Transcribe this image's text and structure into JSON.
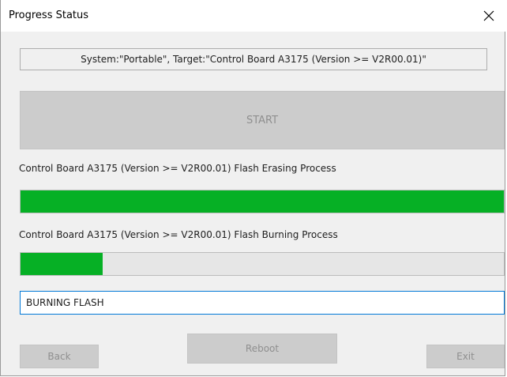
{
  "window": {
    "title": "Progress Status"
  },
  "info": {
    "text": "System:\"Portable\", Target:\"Control Board A3175 (Version >= V2R00.01)\""
  },
  "start_button": {
    "label": "START",
    "enabled": false
  },
  "erase": {
    "label": "Control Board A3175 (Version >= V2R00.01) Flash Erasing Process",
    "progress_percent": 100
  },
  "burn": {
    "label": "Control Board A3175 (Version >= V2R00.01) Flash Burning Process",
    "progress_percent": 17
  },
  "status": {
    "value": "BURNING FLASH"
  },
  "buttons": {
    "back": "Back",
    "reboot": "Reboot",
    "exit": "Exit"
  },
  "colors": {
    "progress_fill": "#06b025",
    "focus_border": "#0078d7",
    "disabled_button": "#cccccc",
    "disabled_text": "#8f8f8f"
  },
  "icons": {
    "close": "close-icon"
  }
}
